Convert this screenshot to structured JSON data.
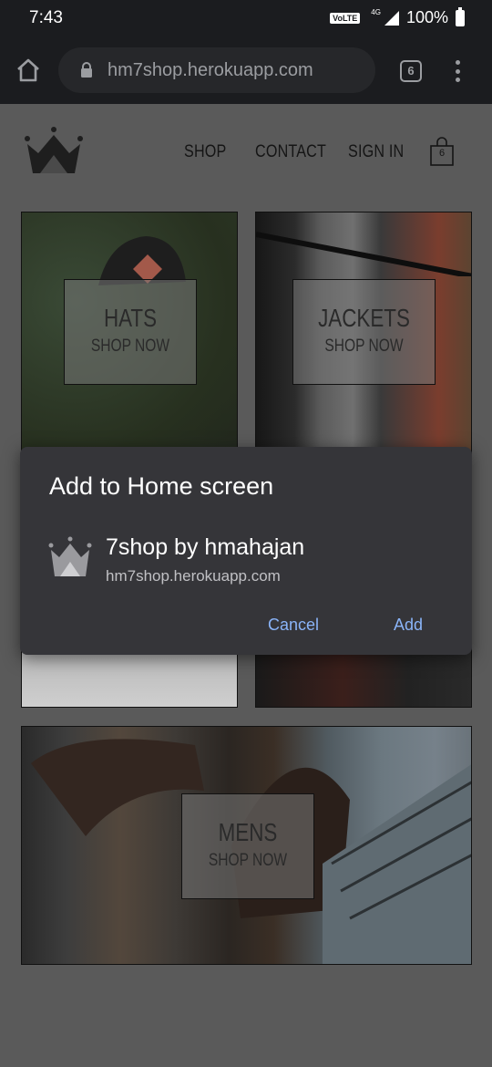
{
  "status": {
    "time": "7:43",
    "volte": "VoLTE",
    "network": "4G",
    "battery": "100%"
  },
  "browser": {
    "url": "hm7shop.herokuapp.com",
    "tab_count": "6"
  },
  "site": {
    "nav": {
      "shop": "SHOP",
      "contact": "CONTACT",
      "sign_in": "SIGN IN"
    },
    "cart_count": "6",
    "tiles": [
      {
        "title": "HATS",
        "cta": "SHOP NOW"
      },
      {
        "title": "JACKETS",
        "cta": "SHOP NOW"
      },
      {
        "title": "MENS",
        "cta": "SHOP NOW"
      }
    ]
  },
  "dialog": {
    "title": "Add to Home screen",
    "app_name": "7shop by hmahajan",
    "app_url": "hm7shop.herokuapp.com",
    "cancel": "Cancel",
    "add": "Add"
  }
}
